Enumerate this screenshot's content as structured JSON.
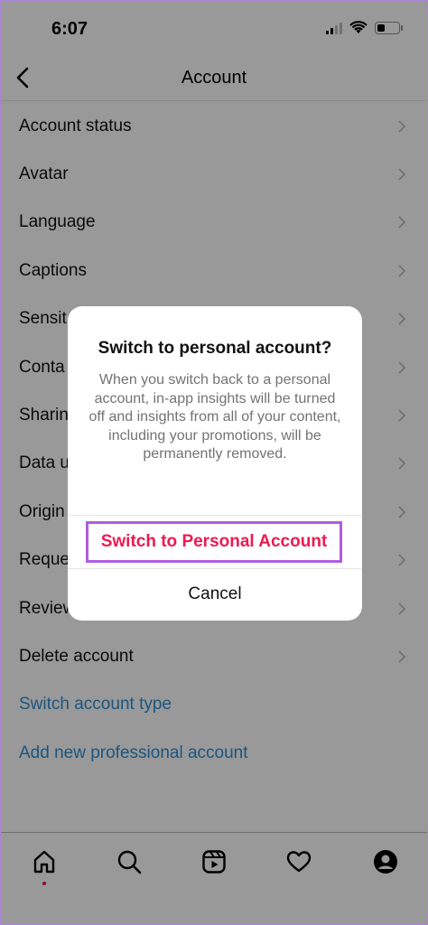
{
  "status_bar": {
    "time": "6:07",
    "icons": [
      "cellular-signal-icon",
      "wifi-icon",
      "battery-icon"
    ]
  },
  "header": {
    "title": "Account",
    "back_icon": "chevron-left-icon"
  },
  "menu": {
    "items": [
      {
        "label": "Account status"
      },
      {
        "label": "Avatar"
      },
      {
        "label": "Language"
      },
      {
        "label": "Captions"
      },
      {
        "label": "Sensit"
      },
      {
        "label": "Conta"
      },
      {
        "label": "Sharin"
      },
      {
        "label": "Data u"
      },
      {
        "label": "Origin"
      },
      {
        "label": "Reque"
      },
      {
        "label": "Review"
      },
      {
        "label": "Delete account"
      }
    ],
    "links": [
      {
        "label": "Switch account type"
      },
      {
        "label": "Add new professional account"
      }
    ]
  },
  "dialog": {
    "title": "Switch to personal account?",
    "body": "When you switch back to a personal account, in-app insights will be turned off and insights from all of your content, including your promotions, will be permanently removed.",
    "primary_action": "Switch to Personal Account",
    "cancel_action": "Cancel"
  },
  "tab_bar": {
    "tabs": [
      "home-icon",
      "search-icon",
      "reels-icon",
      "heart-icon",
      "profile-icon"
    ]
  },
  "colors": {
    "accent_red": "#ED1A50",
    "link_blue": "#2D8FD6",
    "highlight_border": "#B05DE0"
  }
}
